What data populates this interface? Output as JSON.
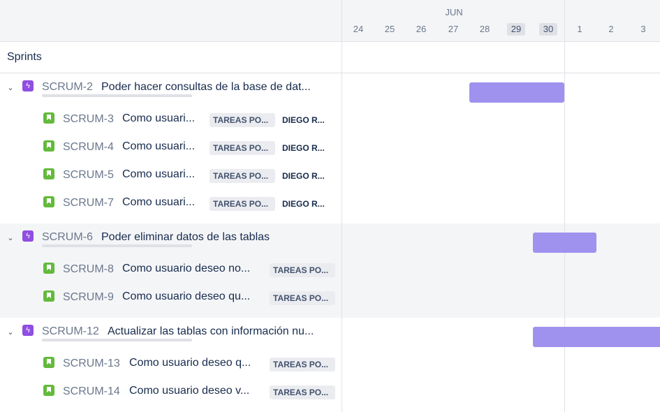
{
  "timeline": {
    "month": "JUN",
    "days": [
      "24",
      "25",
      "26",
      "27",
      "28",
      "29",
      "30",
      "1",
      "2",
      "3"
    ],
    "highlighted_days": [
      "29",
      "30"
    ]
  },
  "sprints_label": "Sprints",
  "colors": {
    "epic": "#904ee2",
    "story": "#63ba3c",
    "bar": "#9e92ee",
    "group_bg": "#f4f5f7"
  },
  "epics": [
    {
      "key": "SCRUM-2",
      "summary": "Poder hacer consultas de la base de dat...",
      "children": [
        {
          "key": "SCRUM-3",
          "summary": "Como usuari...",
          "status": "TAREAS PO...",
          "assignee": "DIEGO R..."
        },
        {
          "key": "SCRUM-4",
          "summary": "Como usuari...",
          "status": "TAREAS PO...",
          "assignee": "DIEGO R..."
        },
        {
          "key": "SCRUM-5",
          "summary": "Como usuari...",
          "status": "TAREAS PO...",
          "assignee": "DIEGO R..."
        },
        {
          "key": "SCRUM-7",
          "summary": "Como usuari...",
          "status": "TAREAS PO...",
          "assignee": "DIEGO R..."
        }
      ]
    },
    {
      "key": "SCRUM-6",
      "summary": "Poder eliminar datos de las tablas",
      "children": [
        {
          "key": "SCRUM-8",
          "summary": "Como usuario deseo no...",
          "status": "TAREAS PO..."
        },
        {
          "key": "SCRUM-9",
          "summary": "Como usuario deseo qu...",
          "status": "TAREAS PO..."
        }
      ]
    },
    {
      "key": "SCRUM-12",
      "summary": "Actualizar las tablas con información nu...",
      "children": [
        {
          "key": "SCRUM-13",
          "summary": "Como usuario deseo q...",
          "status": "TAREAS PO..."
        },
        {
          "key": "SCRUM-14",
          "summary": "Como usuario deseo v...",
          "status": "TAREAS PO..."
        }
      ]
    }
  ]
}
